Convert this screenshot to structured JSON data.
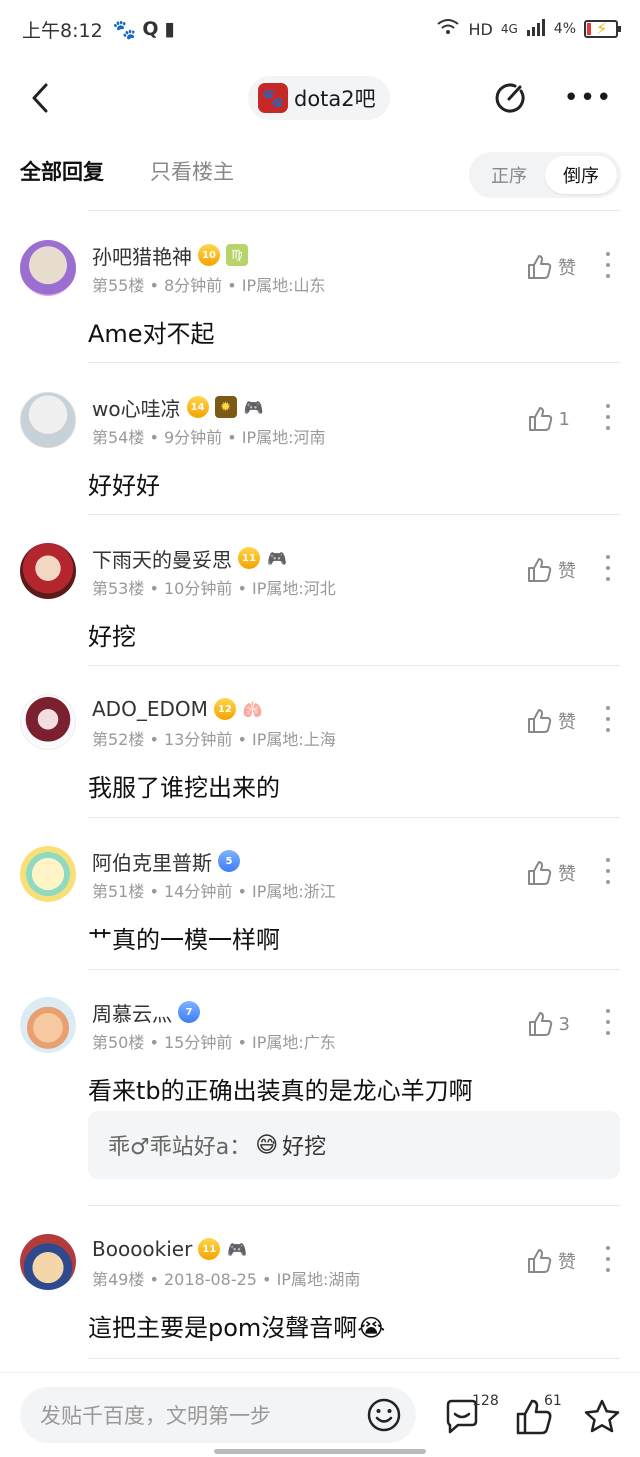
{
  "status_bar": {
    "time": "上午8:12",
    "network": "HD",
    "signal": "4G",
    "battery": "4%",
    "icons": [
      "paw-icon",
      "q-icon",
      "sim-icon",
      "wifi-icon",
      "signal-icon",
      "battery-icon"
    ]
  },
  "nav": {
    "forum_name": "dota2吧",
    "icons": [
      "back-icon",
      "edit-icon",
      "more-icon"
    ]
  },
  "tabs": {
    "all_replies": "全部回复",
    "op_only": "只看楼主",
    "sort_asc": "正序",
    "sort_desc": "倒序",
    "active_sort": "倒序"
  },
  "posts": [
    {
      "username": "孙吧猎艳神",
      "level": "10",
      "badges": [
        "zodiac"
      ],
      "floor": "第55楼",
      "time": "8分钟前",
      "ip": "IP属地:山东",
      "content": "Ame对不起",
      "likes": "赞"
    },
    {
      "username": "wo心哇凉",
      "level": "14",
      "badges": [
        "sun",
        "fan"
      ],
      "floor": "第54楼",
      "time": "9分钟前",
      "ip": "IP属地:河南",
      "content": "好好好",
      "likes": "1"
    },
    {
      "username": "下雨天的曼妥思",
      "level": "11",
      "badges": [
        "fan"
      ],
      "floor": "第53楼",
      "time": "10分钟前",
      "ip": "IP属地:河北",
      "content": "好挖",
      "likes": "赞"
    },
    {
      "username": "ADO_EDOM",
      "level": "12",
      "badges": [
        "fan"
      ],
      "floor": "第52楼",
      "time": "13分钟前",
      "ip": "IP属地:上海",
      "content": "我服了谁挖出来的",
      "likes": "赞"
    },
    {
      "username": "阿伯克里普斯",
      "level": "5",
      "badges": [],
      "floor": "第51楼",
      "time": "14分钟前",
      "ip": "IP属地:浙江",
      "content": "艹真的一模一样啊",
      "likes": "赞"
    },
    {
      "username": "周慕云灬",
      "level": "7",
      "badges": [],
      "floor": "第50楼",
      "time": "15分钟前",
      "ip": "IP属地:广东",
      "content": "看来tb的正确出装真的是龙心羊刀啊",
      "likes": "3",
      "sub_reply": {
        "who": "乖♂乖站好a：",
        "emoji": "😅",
        "text": "好挖"
      }
    },
    {
      "username": "Booookier",
      "level": "11",
      "badges": [
        "fan"
      ],
      "floor": "第49楼",
      "time": "2018-08-25",
      "ip": "IP属地:湖南",
      "content": "這把主要是pom沒聲音啊",
      "content_emoji": "😭",
      "likes": "赞"
    }
  ],
  "bottom_bar": {
    "placeholder": "发贴千百度，文明第一步",
    "comment_count": "128",
    "like_count": "61",
    "icons": [
      "emoji-icon",
      "comment-icon",
      "like-icon",
      "star-icon"
    ]
  },
  "colors": {
    "accent_gold": "#f5a300",
    "accent_blue": "#3d7df5",
    "forum_logo": "#c62828"
  }
}
